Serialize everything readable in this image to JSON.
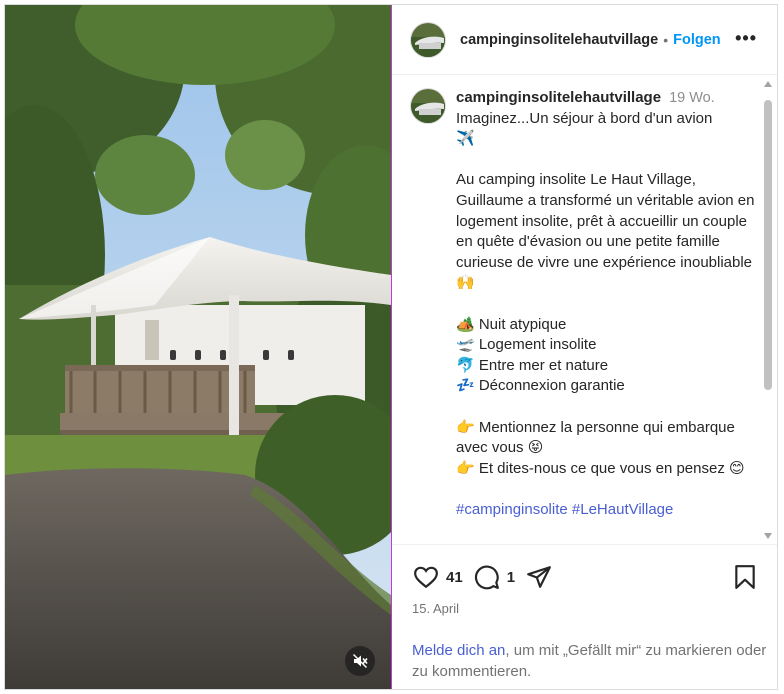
{
  "post": {
    "username": "campinginsolitelehautvillage",
    "follow_separator": "•",
    "follow_label": "Folgen",
    "more_label": "•••",
    "caption_time": "19 Wo.",
    "caption_text": "Imaginez...Un séjour à bord d'un avion\n✈️\n\nAu camping insolite Le Haut Village, Guillaume a transformé un véritable avion en logement insolite, prêt à accueillir un couple en quête d'évasion ou une petite famille curieuse de vivre une expérience inoubliable 🙌\n\n🏕️ Nuit atypique\n🛫 Logement insolite\n🐬 Entre mer et nature\n💤 Déconnexion garantie\n\n👉 Mentionnez la personne qui embarque avec vous 😝\n👉 Et dites-nous ce que vous en pensez 😊\n\n",
    "hashtags": "#campinginsolite #LeHautVillage",
    "likes": "41",
    "comments_count": "1",
    "date": "15. April"
  },
  "login_prompt": {
    "link": "Melde dich an",
    "rest": ", um mit „Gefällt mir“ zu markieren oder zu kommentieren."
  },
  "icons": {
    "mute": "speaker-muted-icon",
    "like": "heart-icon",
    "comment": "comment-bubble-icon",
    "share": "paper-plane-icon",
    "save": "bookmark-icon"
  },
  "colors": {
    "link": "#4a5fd1",
    "follow": "#0095f6",
    "media_border": "#c13bd6"
  }
}
